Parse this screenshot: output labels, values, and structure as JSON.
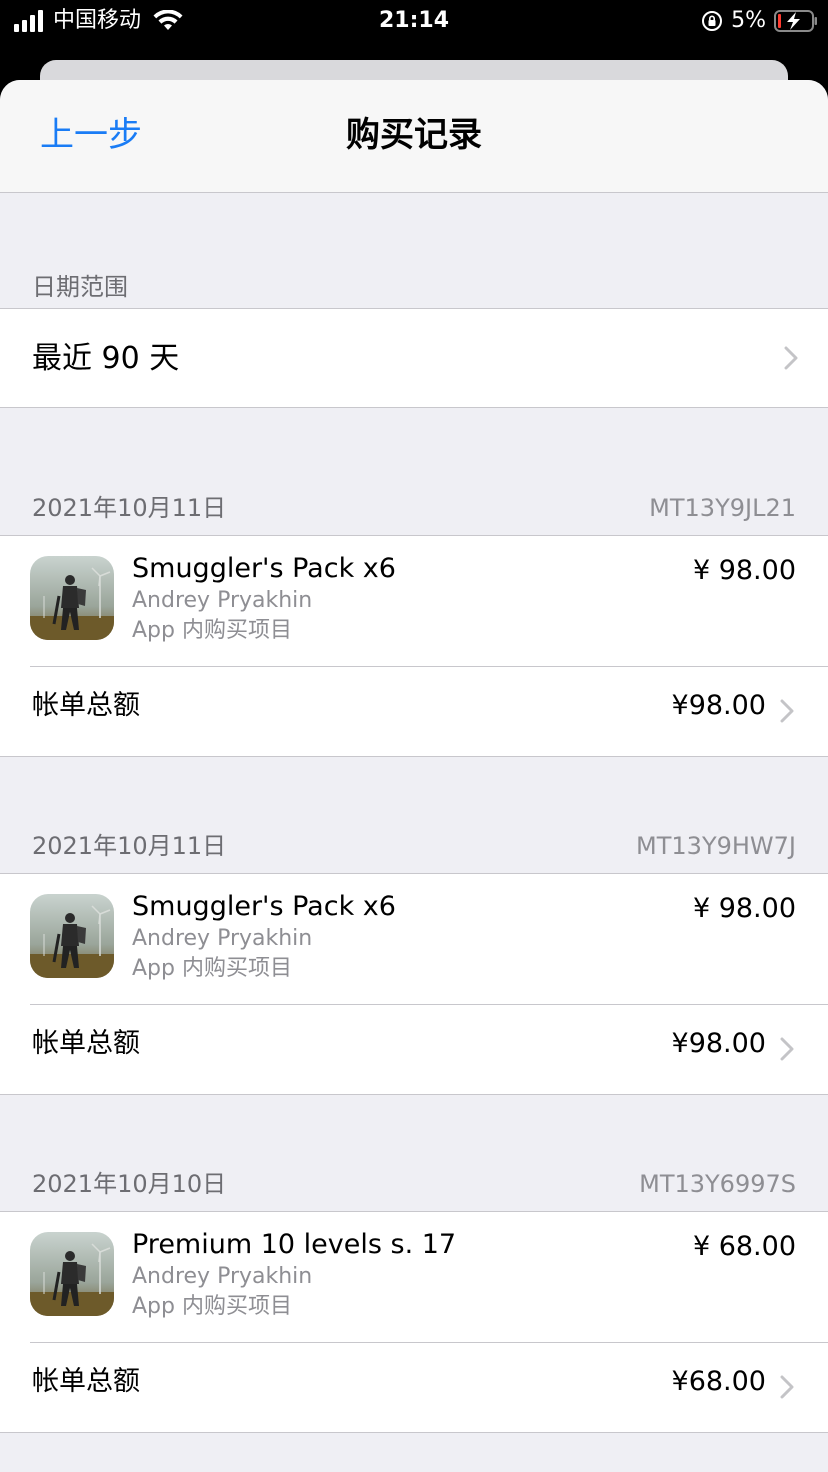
{
  "status_bar": {
    "carrier": "中国移动",
    "time": "21:14",
    "battery_percent": "5%"
  },
  "nav": {
    "back_label": "上一步",
    "title": "购买记录"
  },
  "date_range": {
    "header": "日期范围",
    "value": "最近 90 天"
  },
  "purchases": [
    {
      "date": "2021年10月11日",
      "order_id": "MT13Y9JL21",
      "item_name": "Smuggler's Pack x6",
      "developer": "Andrey Pryakhin",
      "type": "App 内购买项目",
      "price": "¥ 98.00",
      "total_label": "帐单总额",
      "total": "¥98.00"
    },
    {
      "date": "2021年10月11日",
      "order_id": "MT13Y9HW7J",
      "item_name": "Smuggler's Pack x6",
      "developer": "Andrey Pryakhin",
      "type": "App 内购买项目",
      "price": "¥ 98.00",
      "total_label": "帐单总额",
      "total": "¥98.00"
    },
    {
      "date": "2021年10月10日",
      "order_id": "MT13Y6997S",
      "item_name": "Premium 10 levels s. 17",
      "developer": "Andrey Pryakhin",
      "type": "App 内购买项目",
      "price": "¥ 68.00",
      "total_label": "帐单总额",
      "total": "¥68.00"
    }
  ],
  "colors": {
    "accent": "#1a7cf5",
    "background": "#efeff4",
    "secondary_text": "#8e8e93"
  }
}
